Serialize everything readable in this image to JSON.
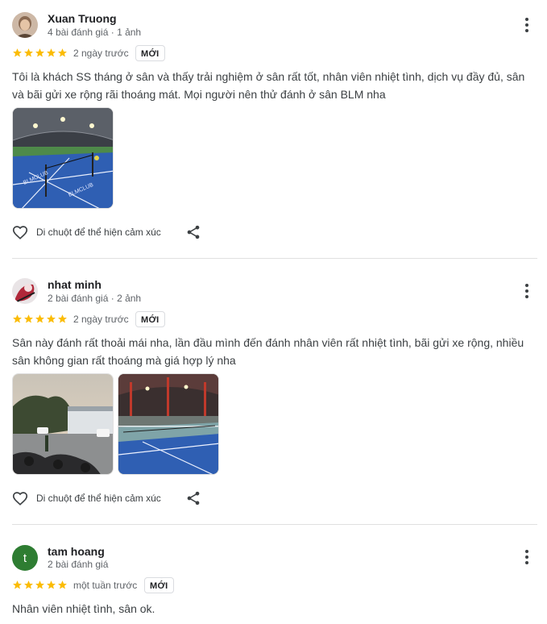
{
  "reviews": [
    {
      "name": "Xuan Truong",
      "meta": "4 bài đánh giá · 1 ảnh",
      "rating": 5,
      "time": "2 ngày trước",
      "badge": "MỚI",
      "text": "Tôi là khách SS tháng ở sân và thấy trải nghiệm ở sân rất tốt, nhân viên nhiệt tình, dịch vụ đầy đủ, sân và bãi gửi xe rộng rãi thoáng mát. Mọi người nên thử đánh ở sân BLM nha",
      "react_label": "Di chuột để thể hiện cảm xúc"
    },
    {
      "name": "nhat minh",
      "meta": "2 bài đánh giá · 2 ảnh",
      "rating": 5,
      "time": "2 ngày trước",
      "badge": "MỚI",
      "text": "Sân này đánh rất thoải mái nha, lần đầu mình đến đánh nhân viên rất nhiệt tình, bãi gửi xe rộng, nhiều sân không gian rất thoáng mà giá hợp lý nha",
      "react_label": "Di chuột để thể hiện cảm xúc"
    },
    {
      "name": "tam hoang",
      "avatar_letter": "t",
      "meta": "2 bài đánh giá",
      "rating": 5,
      "time": "một tuần trước",
      "badge": "MỚI",
      "text": "Nhân viên nhiệt tình, sân ok."
    }
  ],
  "colors": {
    "star": "#fbbc04",
    "avatar_green": "#2e7d32",
    "court_blue": "#2f5fb3",
    "divider": "#e0e0e0"
  },
  "icons": [
    "more-vert-icon",
    "star-icon",
    "heart-outline-icon",
    "share-icon"
  ]
}
